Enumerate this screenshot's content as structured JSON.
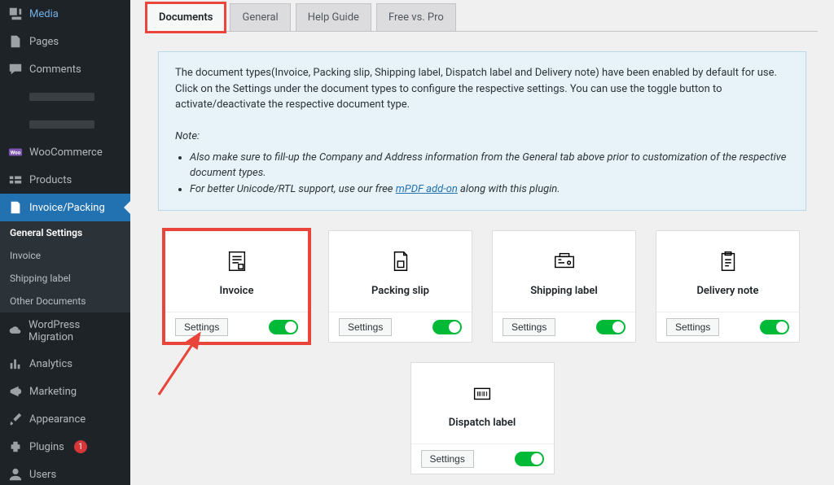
{
  "sidebar": {
    "items": [
      {
        "label": "Media",
        "icon": "media"
      },
      {
        "label": "Pages",
        "icon": "page"
      },
      {
        "label": "Comments",
        "icon": "comment"
      },
      {
        "label": "",
        "icon": "",
        "redacted": true
      },
      {
        "label": "",
        "icon": "",
        "redacted": true
      },
      {
        "label": "WooCommerce",
        "icon": "woo"
      },
      {
        "label": "Products",
        "icon": "products"
      },
      {
        "label": "Invoice/Packing",
        "icon": "doc",
        "current": true
      },
      {
        "label": "WordPress Migration",
        "icon": "cloud"
      },
      {
        "label": "Analytics",
        "icon": "chart"
      },
      {
        "label": "Marketing",
        "icon": "megaphone"
      },
      {
        "label": "Appearance",
        "icon": "brush"
      },
      {
        "label": "Plugins",
        "icon": "plugin",
        "badge": "1"
      },
      {
        "label": "Users",
        "icon": "user"
      }
    ],
    "submenu": [
      {
        "label": "General Settings",
        "active": true
      },
      {
        "label": "Invoice"
      },
      {
        "label": "Shipping label"
      },
      {
        "label": "Other Documents"
      }
    ]
  },
  "tabs": [
    {
      "label": "Documents",
      "active": true,
      "highlight": true
    },
    {
      "label": "General"
    },
    {
      "label": "Help Guide"
    },
    {
      "label": "Free vs. Pro"
    }
  ],
  "notice": {
    "intro": "The document types(Invoice, Packing slip, Shipping label, Dispatch label and Delivery note) have been enabled by default for use. Click on the Settings under the document types to configure the respective settings. You can use the toggle button to activate/deactivate the respective document type.",
    "note_label": "Note:",
    "bullets": [
      "Also make sure to fill-up the Company and Address information from the General tab above prior to customization of the respective document types.",
      "For better Unicode/RTL support, use our free "
    ],
    "link_text": "mPDF add-on",
    "bullet2_suffix": " along with this plugin."
  },
  "cards": [
    {
      "title": "Invoice",
      "settings": "Settings",
      "enabled": true,
      "highlight": true,
      "icon": "invoice"
    },
    {
      "title": "Packing slip",
      "settings": "Settings",
      "enabled": true,
      "icon": "packing"
    },
    {
      "title": "Shipping label",
      "settings": "Settings",
      "enabled": true,
      "icon": "shipping"
    },
    {
      "title": "Delivery note",
      "settings": "Settings",
      "enabled": true,
      "icon": "delivery"
    }
  ],
  "card_row2": {
    "title": "Dispatch label",
    "settings": "Settings",
    "enabled": true,
    "icon": "dispatch"
  }
}
